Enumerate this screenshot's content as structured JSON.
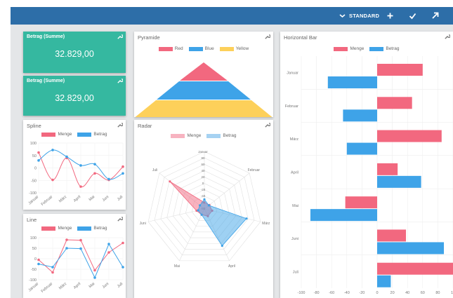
{
  "toolbar": {
    "standard_label": "STANDARD",
    "icons": [
      "chevron-down-icon",
      "plus-icon",
      "check-icon",
      "expand-icon"
    ]
  },
  "kpi_cards": [
    {
      "title": "Betrag (Summe)",
      "value": "32.829,00"
    },
    {
      "title": "Betrag (Summe)",
      "value": "32.829,00"
    }
  ],
  "charts": {
    "pyramide": {
      "title": "Pyramide",
      "legend": [
        {
          "label": "Red",
          "color": "#f2687f"
        },
        {
          "label": "Blue",
          "color": "#3ea3e8"
        },
        {
          "label": "Yellow",
          "color": "#fdd05a"
        }
      ]
    },
    "spline": {
      "title": "Spline",
      "legend": [
        {
          "label": "Menge",
          "color": "#f2687f"
        },
        {
          "label": "Betrag",
          "color": "#3ea3e8"
        }
      ],
      "y_ticks": [
        "100",
        "50",
        "0",
        "-50",
        "-100"
      ]
    },
    "line": {
      "title": "Line",
      "legend": [
        {
          "label": "Menge",
          "color": "#f2687f"
        },
        {
          "label": "Betrag",
          "color": "#3ea3e8"
        }
      ],
      "y_ticks": [
        "100",
        "50",
        "0",
        "-50",
        "-100"
      ]
    },
    "radar": {
      "title": "Radar",
      "legend": [
        {
          "label": "Menge",
          "color": "#f7b3c0"
        },
        {
          "label": "Betrag",
          "color": "#a6d2f2"
        }
      ],
      "scale_labels": [
        "Januar",
        "80",
        "60",
        "40",
        "20",
        "0",
        "-20",
        "-40",
        "-60",
        "-80"
      ]
    },
    "hbar": {
      "title": "Horizontal Bar",
      "legend": [
        {
          "label": "Menge",
          "color": "#f2687f"
        },
        {
          "label": "Betrag",
          "color": "#3ea3e8"
        }
      ],
      "x_ticks": [
        "-100",
        "-80",
        "-60",
        "-40",
        "-20",
        "0",
        "20",
        "40",
        "60",
        "80",
        "10"
      ]
    }
  },
  "chart_data": [
    {
      "type": "area",
      "title": "Pyramide",
      "categories": [
        "Red",
        "Blue",
        "Yellow"
      ],
      "values": [
        1,
        1,
        1
      ]
    },
    {
      "type": "line",
      "title": "Spline",
      "categories": [
        "Januar",
        "Februar",
        "März",
        "April",
        "Mai",
        "Juni",
        "Juli"
      ],
      "series": [
        {
          "name": "Menge",
          "values": [
            62,
            -48,
            40,
            -75,
            -22,
            -48,
            5
          ]
        },
        {
          "name": "Betrag",
          "values": [
            30,
            72,
            45,
            10,
            15,
            -45,
            -22
          ]
        }
      ],
      "ylim": [
        -100,
        100
      ]
    },
    {
      "type": "line",
      "title": "Line",
      "categories": [
        "Januar",
        "Februar",
        "März",
        "April",
        "Mai",
        "Juni",
        "Juli"
      ],
      "series": [
        {
          "name": "Menge",
          "values": [
            -5,
            -65,
            90,
            88,
            -55,
            30,
            75
          ]
        },
        {
          "name": "Betrag",
          "values": [
            -25,
            -40,
            50,
            48,
            -90,
            70,
            -40
          ]
        }
      ],
      "ylim": [
        -100,
        100
      ]
    },
    {
      "type": "radar",
      "title": "Radar",
      "categories": [
        "Januar",
        "Februar",
        "März",
        "April",
        "Mai",
        "Juni",
        "Juli"
      ],
      "series": [
        {
          "name": "Menge",
          "values": [
            -60,
            -60,
            -55,
            -55,
            -60,
            -55,
            58
          ]
        },
        {
          "name": "Betrag",
          "values": [
            -50,
            -62,
            55,
            48,
            -60,
            -60,
            -62
          ]
        }
      ],
      "ylim": [
        -80,
        100
      ]
    },
    {
      "type": "bar",
      "title": "Horizontal Bar",
      "categories": [
        "Januar",
        "Februar",
        "März",
        "April",
        "Mai",
        "Juni",
        "Juli"
      ],
      "series": [
        {
          "name": "Menge",
          "values": [
            60,
            46,
            85,
            27,
            -42,
            38,
            100
          ]
        },
        {
          "name": "Betrag",
          "values": [
            -65,
            -45,
            -40,
            58,
            -88,
            88,
            18
          ]
        }
      ],
      "xlim": [
        -100,
        100
      ]
    }
  ]
}
